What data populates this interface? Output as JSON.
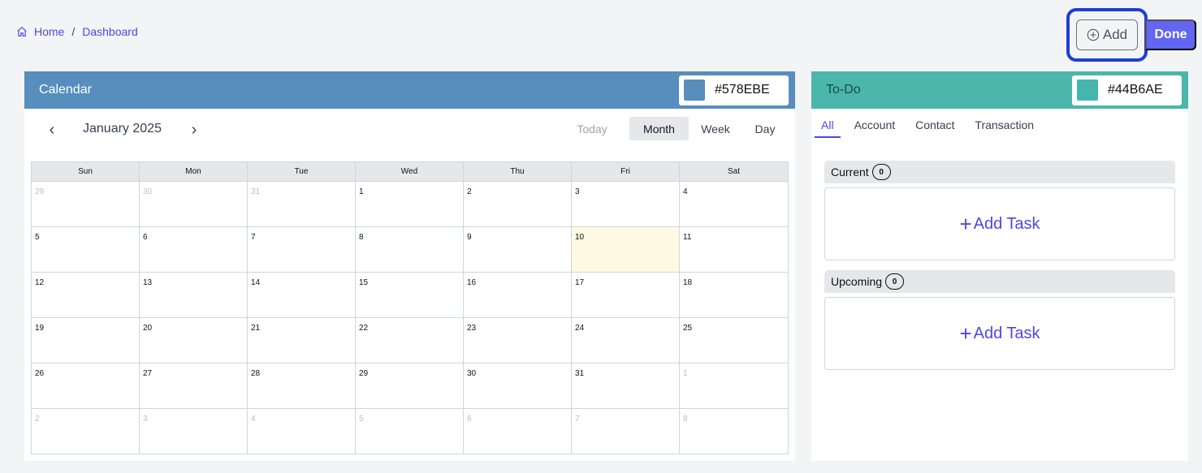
{
  "breadcrumb": {
    "home": "Home",
    "separator": "/",
    "current": "Dashboard"
  },
  "toolbar": {
    "add_label": "Add",
    "done_label": "Done"
  },
  "calendar": {
    "title": "Calendar",
    "color": "#578EBE",
    "month_label": "January 2025",
    "prev_icon": "‹",
    "next_icon": "›",
    "views": {
      "today": "Today",
      "month": "Month",
      "week": "Week",
      "day": "Day"
    },
    "weekdays": [
      "Sun",
      "Mon",
      "Tue",
      "Wed",
      "Thu",
      "Fri",
      "Sat"
    ],
    "days": [
      {
        "d": "29",
        "m": true
      },
      {
        "d": "30",
        "m": true
      },
      {
        "d": "31",
        "m": true
      },
      {
        "d": "1"
      },
      {
        "d": "2"
      },
      {
        "d": "3"
      },
      {
        "d": "4"
      },
      {
        "d": "5"
      },
      {
        "d": "6"
      },
      {
        "d": "7"
      },
      {
        "d": "8"
      },
      {
        "d": "9"
      },
      {
        "d": "10",
        "t": true
      },
      {
        "d": "11"
      },
      {
        "d": "12"
      },
      {
        "d": "13"
      },
      {
        "d": "14"
      },
      {
        "d": "15"
      },
      {
        "d": "16"
      },
      {
        "d": "17"
      },
      {
        "d": "18"
      },
      {
        "d": "19"
      },
      {
        "d": "20"
      },
      {
        "d": "21"
      },
      {
        "d": "22"
      },
      {
        "d": "23"
      },
      {
        "d": "24"
      },
      {
        "d": "25"
      },
      {
        "d": "26"
      },
      {
        "d": "27"
      },
      {
        "d": "28"
      },
      {
        "d": "29"
      },
      {
        "d": "30"
      },
      {
        "d": "31"
      },
      {
        "d": "1",
        "m": true
      },
      {
        "d": "2",
        "m": true
      },
      {
        "d": "3",
        "m": true
      },
      {
        "d": "4",
        "m": true
      },
      {
        "d": "5",
        "m": true
      },
      {
        "d": "6",
        "m": true
      },
      {
        "d": "7",
        "m": true
      },
      {
        "d": "8",
        "m": true
      }
    ]
  },
  "todo": {
    "title": "To-Do",
    "color": "#44B6AE",
    "tabs": {
      "all": "All",
      "account": "Account",
      "contact": "Contact",
      "transaction": "Transaction"
    },
    "current": {
      "label": "Current",
      "count": "0",
      "add_task": "Add Task"
    },
    "upcoming": {
      "label": "Upcoming",
      "count": "0",
      "add_task": "Add Task"
    }
  },
  "colors": {
    "accent": "#4f46e5",
    "done_bg": "#6366f1",
    "focus_ring": "#1d3ed8",
    "calendar_header": "#578ebe",
    "todo_header": "#4bb6ab",
    "today_cell": "#fef9e3"
  }
}
